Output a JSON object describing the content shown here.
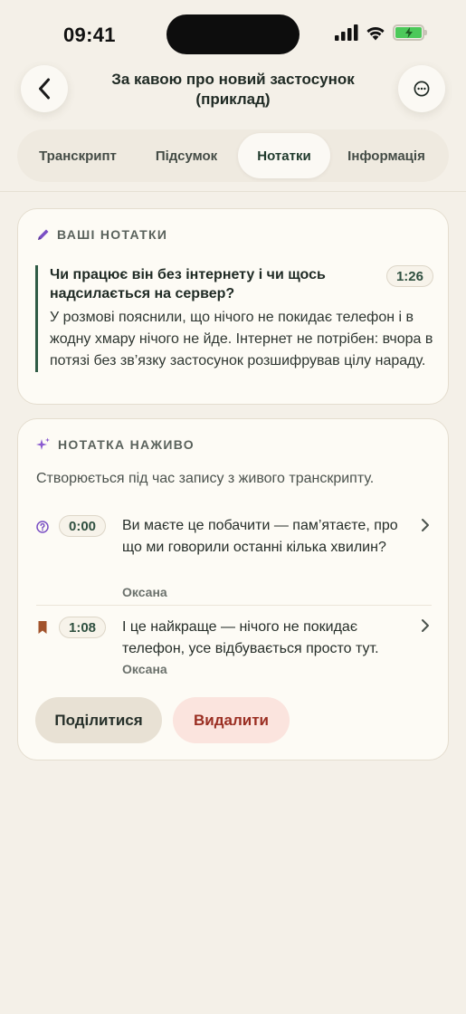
{
  "status_bar": {
    "time": "09:41"
  },
  "header": {
    "title": "За кавою про новий застосунок (приклад)",
    "back_icon": "chevron-left-icon",
    "more_icon": "ellipsis-circle-icon"
  },
  "tabs": [
    {
      "label": "Транскрипт",
      "active": false
    },
    {
      "label": "Підсумок",
      "active": false
    },
    {
      "label": "Нотатки",
      "active": true
    },
    {
      "label": "Інформація",
      "active": false
    }
  ],
  "your_notes": {
    "heading": "ВАШІ НОТАТКИ",
    "icon": "pencil-icon",
    "note": {
      "question": "Чи працює він без інтернету і чи щось надсилається на сервер?",
      "timestamp": "1:26",
      "answer": "У розмові пояснили, що нічого не покидає телефон і в жодну хмару нічого не йде. Інтернет не потрібен: вчора в потязі без зв’язку застосунок розшифрував цілу нараду."
    }
  },
  "live_note": {
    "heading": "НОТАТКА НАЖИВО",
    "icon": "sparkles-icon",
    "subtitle": "Створюється під час запису з живого транскрипту.",
    "items": [
      {
        "icon": "question-circle-icon",
        "time": "0:00",
        "text": "Ви маєте це побачити — пам’ятаєте, про що ми говорили останні кілька хвилин?",
        "speaker": "Оксана"
      },
      {
        "icon": "bookmark-icon",
        "time": "1:08",
        "text": "І це найкраще — нічого не покидає телефон, усе відбувається просто тут.",
        "speaker": "Оксана"
      }
    ],
    "share_label": "Поділитися",
    "delete_label": "Видалити"
  },
  "colors": {
    "background": "#f4f0e8",
    "accent_green": "#2f5b45",
    "accent_purple": "#7a4fc4",
    "bookmark_brown": "#a2532c",
    "delete_red": "#9a2e22",
    "delete_bg": "#fbe4de"
  }
}
